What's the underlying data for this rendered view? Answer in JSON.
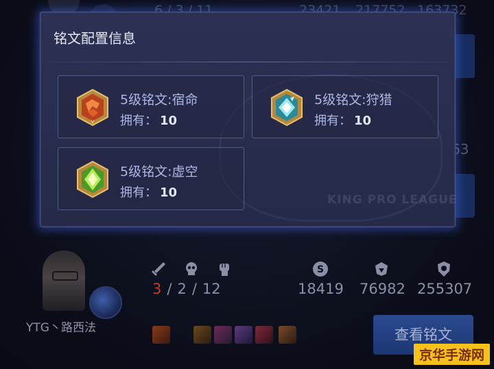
{
  "background": {
    "top_row": {
      "kda": "6  /  3  /  11",
      "stat1": "23421",
      "stat2": "217752",
      "stat3": "163732"
    },
    "side_number": "63",
    "player": {
      "name": "YTG丶路西法",
      "kills": "3",
      "deaths": "2",
      "assists": "12",
      "stat1": "18419",
      "stat2": "76982",
      "stat3": "255307",
      "kda_separator": "/"
    },
    "view_button_label": "查看铭文",
    "watermark": "京华手游网",
    "modal_watermark_text": "KING PRO LEAGUE"
  },
  "modal": {
    "title": "铭文配置信息",
    "own_label": "拥有：",
    "inscriptions": [
      {
        "name": "5级铭文:宿命",
        "count": "10",
        "color": "red",
        "icon": "red-inscription-gem-icon"
      },
      {
        "name": "5级铭文:狩猎",
        "count": "10",
        "color": "blue",
        "icon": "blue-inscription-gem-icon"
      },
      {
        "name": "5级铭文:虚空",
        "count": "10",
        "color": "green",
        "icon": "green-inscription-gem-icon"
      }
    ]
  },
  "colors": {
    "accent_glow": "#4664e6",
    "kills_red": "#c83a2e",
    "watermark_yellow": "#f4c21a"
  }
}
